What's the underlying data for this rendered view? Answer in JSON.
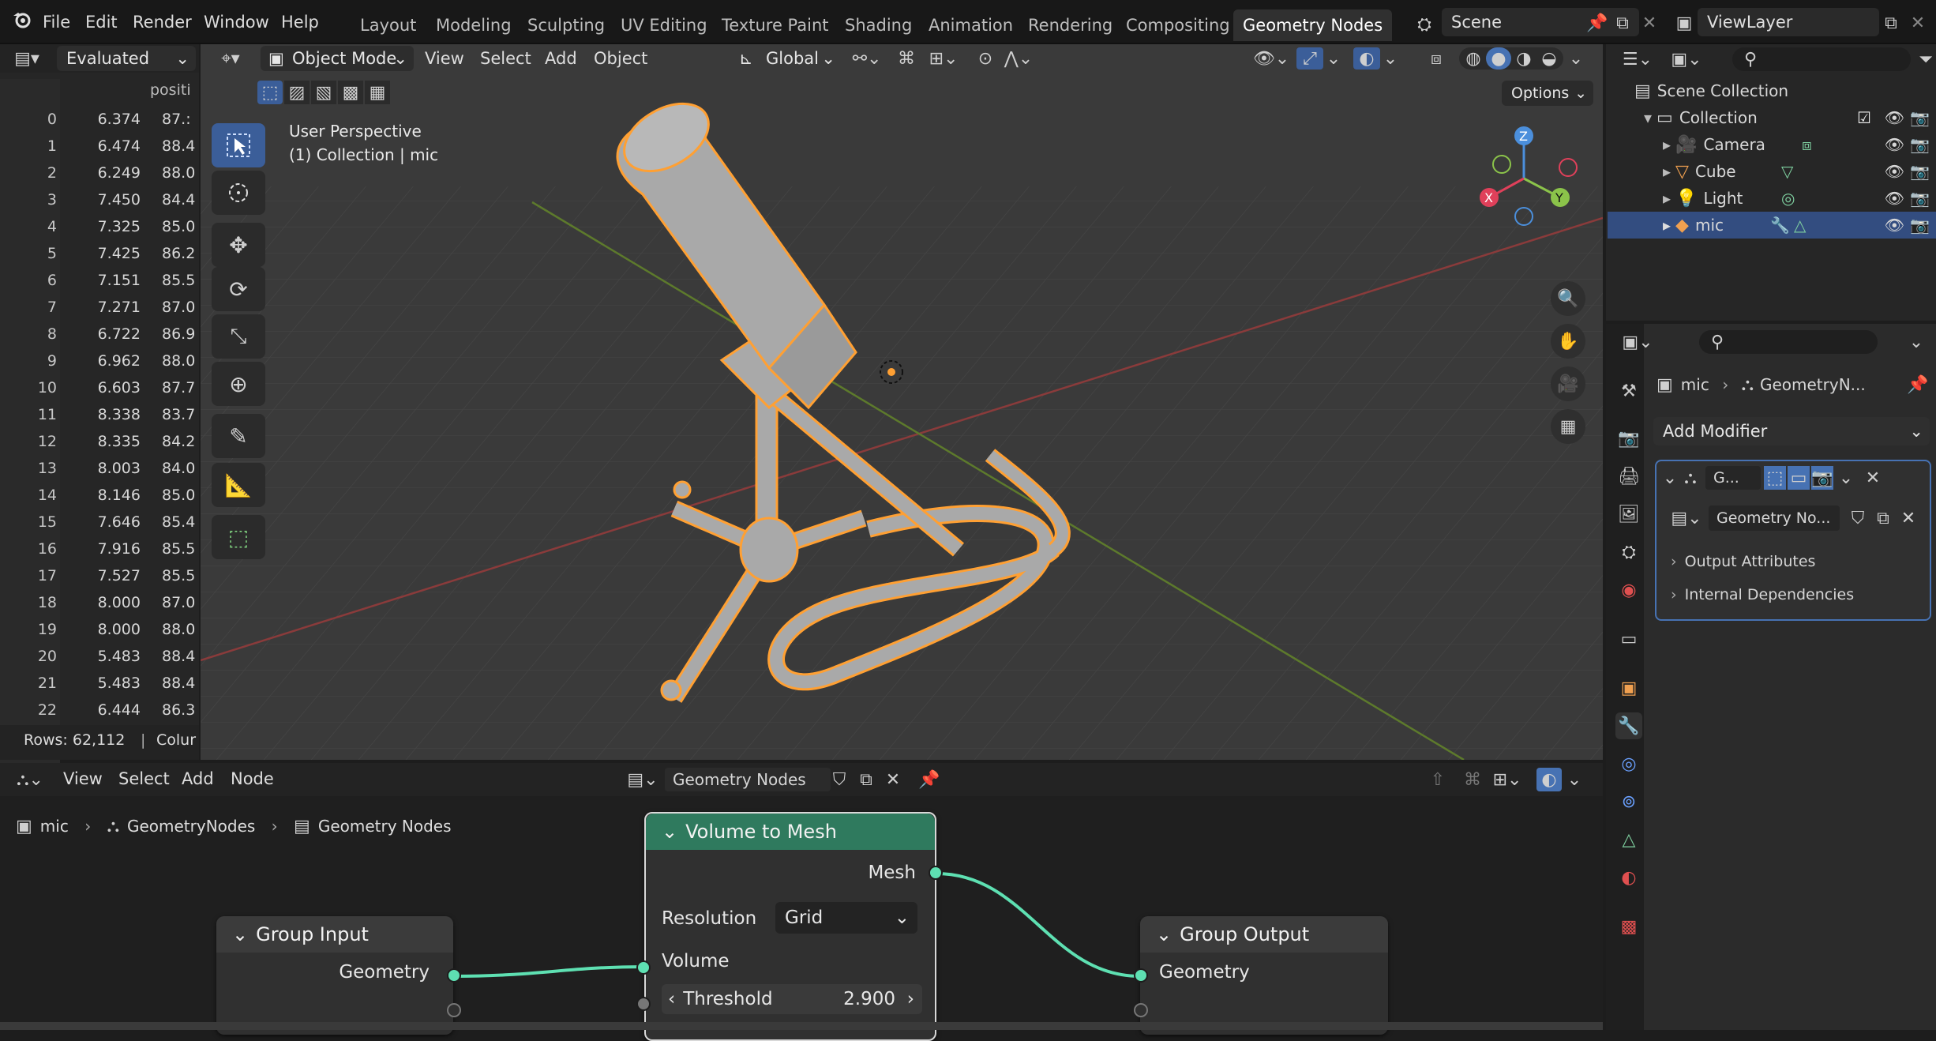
{
  "menu": {
    "file": "File",
    "edit": "Edit",
    "render": "Render",
    "window": "Window",
    "help": "Help"
  },
  "workspaces": [
    "Layout",
    "Modeling",
    "Sculpting",
    "UV Editing",
    "Texture Paint",
    "Shading",
    "Animation",
    "Rendering",
    "Compositing",
    "Geometry Nodes"
  ],
  "active_workspace": "Geometry Nodes",
  "scene": {
    "name": "Scene"
  },
  "view_layer": {
    "name": "ViewLayer"
  },
  "spreadsheet": {
    "mode": "Evaluated",
    "column": "positi",
    "rows": [
      {
        "i": "0",
        "a": "6.374",
        "b": "87.:"
      },
      {
        "i": "1",
        "a": "6.474",
        "b": "88.4"
      },
      {
        "i": "2",
        "a": "6.249",
        "b": "88.0"
      },
      {
        "i": "3",
        "a": "7.450",
        "b": "84.4"
      },
      {
        "i": "4",
        "a": "7.325",
        "b": "85.0"
      },
      {
        "i": "5",
        "a": "7.425",
        "b": "86.2"
      },
      {
        "i": "6",
        "a": "7.151",
        "b": "85.5"
      },
      {
        "i": "7",
        "a": "7.271",
        "b": "87.0"
      },
      {
        "i": "8",
        "a": "6.722",
        "b": "86.9"
      },
      {
        "i": "9",
        "a": "6.962",
        "b": "88.0"
      },
      {
        "i": "10",
        "a": "6.603",
        "b": "87.7"
      },
      {
        "i": "11",
        "a": "8.338",
        "b": "83.7"
      },
      {
        "i": "12",
        "a": "8.335",
        "b": "84.2"
      },
      {
        "i": "13",
        "a": "8.003",
        "b": "84.0"
      },
      {
        "i": "14",
        "a": "8.146",
        "b": "85.0"
      },
      {
        "i": "15",
        "a": "7.646",
        "b": "85.4"
      },
      {
        "i": "16",
        "a": "7.916",
        "b": "85.5"
      },
      {
        "i": "17",
        "a": "7.527",
        "b": "85.5"
      },
      {
        "i": "18",
        "a": "8.000",
        "b": "87.0"
      },
      {
        "i": "19",
        "a": "8.000",
        "b": "88.0"
      },
      {
        "i": "20",
        "a": "5.483",
        "b": "88.4"
      },
      {
        "i": "21",
        "a": "5.483",
        "b": "88.4"
      },
      {
        "i": "22",
        "a": "6.444",
        "b": "86.3"
      }
    ],
    "footer_rows": "Rows: 62,112",
    "footer_cols": "Colur"
  },
  "viewport": {
    "mode": "Object Mode",
    "menus": {
      "view": "View",
      "select": "Select",
      "add": "Add",
      "object": "Object"
    },
    "transform": "Global",
    "options": "Options",
    "overlay_line1": "User Perspective",
    "overlay_line2": "(1) Collection | mic"
  },
  "outliner": {
    "root": "Scene Collection",
    "collection": "Collection",
    "items": [
      "Camera",
      "Cube",
      "Light",
      "mic"
    ],
    "selected": "mic"
  },
  "properties": {
    "breadcrumb_obj": "mic",
    "breadcrumb_mod": "GeometryN...",
    "add_modifier": "Add Modifier",
    "modifier_name": "G...",
    "node_group": "Geometry No...",
    "sections": [
      "Output Attributes",
      "Internal Dependencies"
    ]
  },
  "node_editor": {
    "menus": {
      "view": "View",
      "select": "Select",
      "add": "Add",
      "node": "Node"
    },
    "tree_name": "Geometry Nodes",
    "breadcrumb": [
      "mic",
      "GeometryNodes",
      "Geometry Nodes"
    ],
    "nodes": {
      "volume_to_mesh": {
        "title": "Volume to Mesh",
        "out_mesh": "Mesh",
        "resolution_label": "Resolution",
        "resolution_value": "Grid",
        "in_volume": "Volume",
        "threshold_label": "Threshold",
        "threshold_value": "2.900"
      },
      "group_input": {
        "title": "Group Input",
        "out_geometry": "Geometry"
      },
      "group_output": {
        "title": "Group Output",
        "in_geometry": "Geometry"
      }
    }
  },
  "colors": {
    "accent": "#4772b3",
    "selection": "#ffa033",
    "socket_geometry": "#5ee0b2",
    "node_header_geo": "#2f7a5e"
  }
}
